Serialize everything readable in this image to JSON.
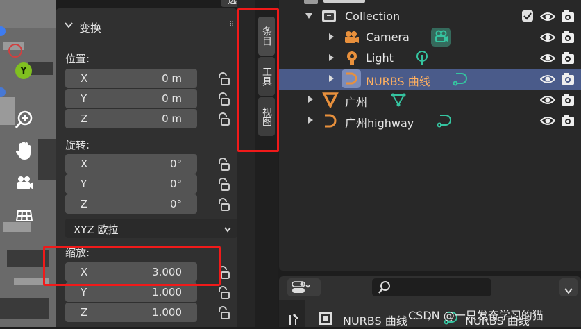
{
  "header": {
    "options_label": "选项"
  },
  "transform_panel": {
    "title": "变换",
    "location": {
      "label": "位置:",
      "x": {
        "axis": "X",
        "value": "0 m"
      },
      "y": {
        "axis": "Y",
        "value": "0 m"
      },
      "z": {
        "axis": "Z",
        "value": "0 m"
      }
    },
    "rotation": {
      "label": "旋转:",
      "x": {
        "axis": "X",
        "value": "0°"
      },
      "y": {
        "axis": "Y",
        "value": "0°"
      },
      "z": {
        "axis": "Z",
        "value": "0°"
      }
    },
    "rotation_mode": "XYZ 欧拉",
    "scale": {
      "label": "缩放:",
      "x": {
        "axis": "X",
        "value": "3.000"
      },
      "y": {
        "axis": "Y",
        "value": "1.000"
      },
      "z": {
        "axis": "Z",
        "value": "1.000"
      }
    }
  },
  "side_tabs": [
    "条目",
    "工具",
    "视图"
  ],
  "gizmo": {
    "y_axis_label": "Y"
  },
  "outliner": {
    "items": [
      {
        "name": "Collection",
        "icon": "collection-icon"
      },
      {
        "name": "Camera",
        "icon": "camera-object-icon"
      },
      {
        "name": "Light",
        "icon": "light-object-icon"
      },
      {
        "name": "NURBS 曲线",
        "icon": "curve-object-icon"
      },
      {
        "name": "广州",
        "icon": "mesh-object-icon"
      },
      {
        "name": "广州highway",
        "icon": "curve-object-icon"
      }
    ]
  },
  "properties": {
    "object_name": "NURBS 曲线",
    "data_name": "NURBS 曲线"
  },
  "watermark": "CSDN @一只发奋学习的猫",
  "colors": {
    "selected_row": "#4a5b8a",
    "highlight_box": "#f01a1a",
    "curve_orange": "#e8903c",
    "data_green": "#35c4a0"
  }
}
